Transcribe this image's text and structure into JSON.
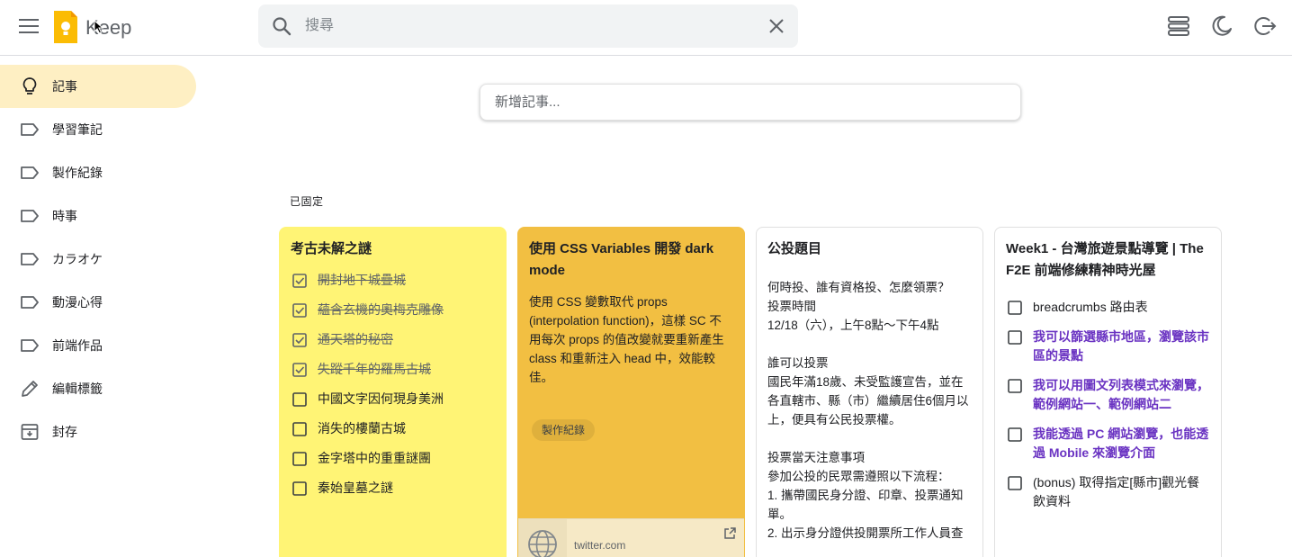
{
  "app": {
    "name": "Keep"
  },
  "search": {
    "placeholder": "搜尋"
  },
  "sidebar": {
    "items": [
      {
        "label": "記事",
        "icon": "lightbulb-icon",
        "active": true
      },
      {
        "label": "學習筆記",
        "icon": "label-icon"
      },
      {
        "label": "製作紀錄",
        "icon": "label-icon"
      },
      {
        "label": "時事",
        "icon": "label-icon"
      },
      {
        "label": "カラオケ",
        "icon": "label-icon"
      },
      {
        "label": "動漫心得",
        "icon": "label-icon"
      },
      {
        "label": "前端作品",
        "icon": "label-icon"
      },
      {
        "label": "編輯標籤",
        "icon": "pencil-icon"
      },
      {
        "label": "封存",
        "icon": "archive-icon"
      }
    ]
  },
  "new_note": {
    "placeholder": "新增記事..."
  },
  "pinned": {
    "label": "已固定"
  },
  "notes": [
    {
      "title": "考古未解之謎",
      "color": "#fff475",
      "items": [
        {
          "text": "開封地下城疊城",
          "checked": true
        },
        {
          "text": "蘊含玄機的奧梅克雕像",
          "checked": true
        },
        {
          "text": "通天塔的秘密",
          "checked": true
        },
        {
          "text": "失蹤千年的羅馬古城",
          "checked": true
        },
        {
          "text": "中國文字因何現身美洲",
          "checked": false
        },
        {
          "text": "消失的樓蘭古城",
          "checked": false
        },
        {
          "text": "金字塔中的重重謎團",
          "checked": false
        },
        {
          "text": "秦始皇墓之謎",
          "checked": false
        }
      ]
    },
    {
      "title": "使用 CSS Variables 開發 dark mode",
      "color": "#f2bf42",
      "body": "使用 CSS 變數取代 props (interpolation function)，這樣 SC 不用每次 props 的值改變就要重新產生 class 和重新注入 head 中，效能較佳。",
      "label": "製作紀錄",
      "link_domain": "twitter.com"
    },
    {
      "title": "公投題目",
      "color": "#ffffff",
      "lines": [
        "何時投、誰有資格投、怎麼領票？",
        "投票時間",
        "12/18（六），上午8點～下午4點",
        "",
        "誰可以投票",
        "國民年滿18歲、未受監護宣告，並在各直轄市、縣（市）繼續居住6個月以上，便具有公民投票權。",
        "",
        "投票當天注意事項",
        "參加公投的民眾需遵照以下流程：",
        "1. 攜帶國民身分證、印章、投票通知單。",
        "2. 出示身分證供投開票所工作人員查"
      ]
    },
    {
      "title": "Week1 - 台灣旅遊景點導覽 | The F2E 前端修練精神時光屋",
      "color": "#ffffff",
      "items": [
        {
          "text": "breadcrumbs 路由表",
          "checked": false,
          "style": "normal"
        },
        {
          "text": "我可以篩選縣市地區，瀏覽該市區的景點",
          "checked": false,
          "style": "purple"
        },
        {
          "text": "我可以用圖文列表模式來瀏覽，範例網站一、範例網站二",
          "checked": false,
          "style": "purple"
        },
        {
          "text": "我能透過 PC 網站瀏覽，也能透過 Mobile 來瀏覽介面",
          "checked": false,
          "style": "purple"
        },
        {
          "text": "(bonus) 取得指定[縣市]觀光餐飲資料",
          "checked": false,
          "style": "normal"
        }
      ]
    }
  ]
}
